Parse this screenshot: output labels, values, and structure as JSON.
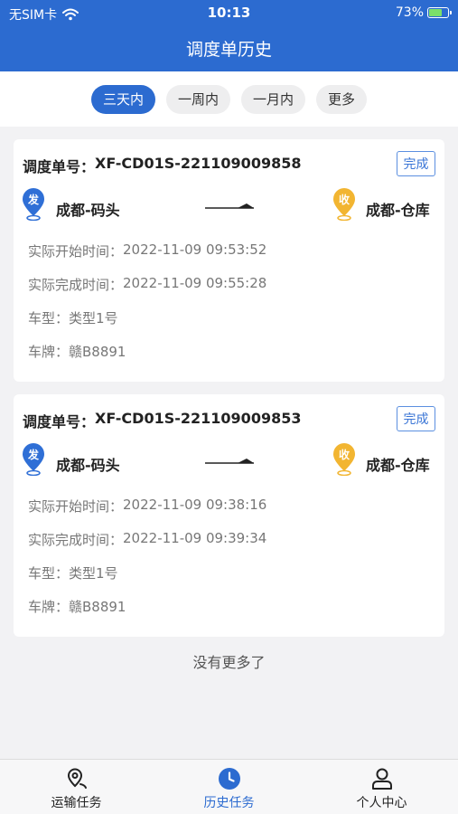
{
  "status_bar": {
    "carrier": "无SIM卡",
    "time": "10:13",
    "battery": "73%"
  },
  "nav": {
    "title": "调度单历史"
  },
  "filters": [
    {
      "label": "三天内",
      "active": true
    },
    {
      "label": "一周内",
      "active": false
    },
    {
      "label": "一月内",
      "active": false
    },
    {
      "label": "更多",
      "active": false
    }
  ],
  "orders": [
    {
      "order_label": "调度单号：",
      "order_no": "XF-CD01S-221109009858",
      "status": "完成",
      "from_badge": "发",
      "from": "成都-码头",
      "to_badge": "收",
      "to": "成都-仓库",
      "start_label": "实际开始时间：",
      "start_time": "2022-11-09 09:53:52",
      "end_label": "实际完成时间：",
      "end_time": "2022-11-09 09:55:28",
      "vehicle_type_label": "车型：",
      "vehicle_type": "类型1号",
      "plate_label": "车牌：",
      "plate": "赣B8891"
    },
    {
      "order_label": "调度单号：",
      "order_no": "XF-CD01S-221109009853",
      "status": "完成",
      "from_badge": "发",
      "from": "成都-码头",
      "to_badge": "收",
      "to": "成都-仓库",
      "start_label": "实际开始时间：",
      "start_time": "2022-11-09 09:38:16",
      "end_label": "实际完成时间：",
      "end_time": "2022-11-09 09:39:34",
      "vehicle_type_label": "车型：",
      "vehicle_type": "类型1号",
      "plate_label": "车牌：",
      "plate": "赣B8891"
    }
  ],
  "list_end_text": "没有更多了",
  "tabbar": [
    {
      "label": "运输任务",
      "icon": "location-pin-icon",
      "active": false
    },
    {
      "label": "历史任务",
      "icon": "clock-icon",
      "active": true
    },
    {
      "label": "个人中心",
      "icon": "person-icon",
      "active": false
    }
  ],
  "colors": {
    "primary": "#2c6bd0",
    "from_pin": "#2f6fd6",
    "to_pin": "#f2b531",
    "battery": "#7be06a"
  }
}
